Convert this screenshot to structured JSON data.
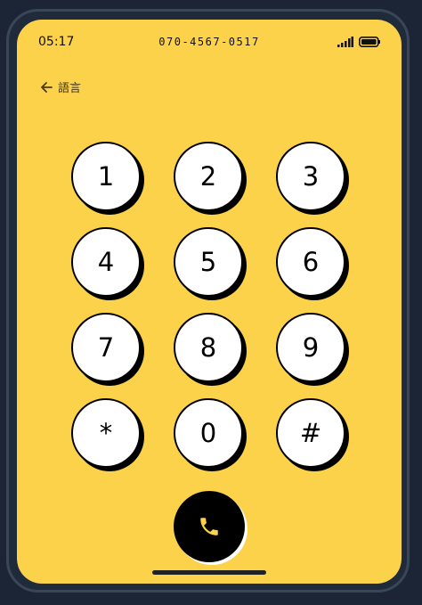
{
  "status": {
    "time": "05:17",
    "number": "070-4567-0517"
  },
  "nav": {
    "back_label": "語言"
  },
  "keypad": {
    "keys": [
      "1",
      "2",
      "3",
      "4",
      "5",
      "6",
      "7",
      "8",
      "9",
      "*",
      "0",
      "#"
    ]
  },
  "colors": {
    "screen_bg": "#fbd24a",
    "key_bg": "#ffffff",
    "call_bg": "#000000",
    "call_icon": "#fbd24a"
  },
  "icons": {
    "back": "arrow-left-icon",
    "call": "phone-icon",
    "signal": "signal-icon",
    "battery": "battery-icon"
  }
}
